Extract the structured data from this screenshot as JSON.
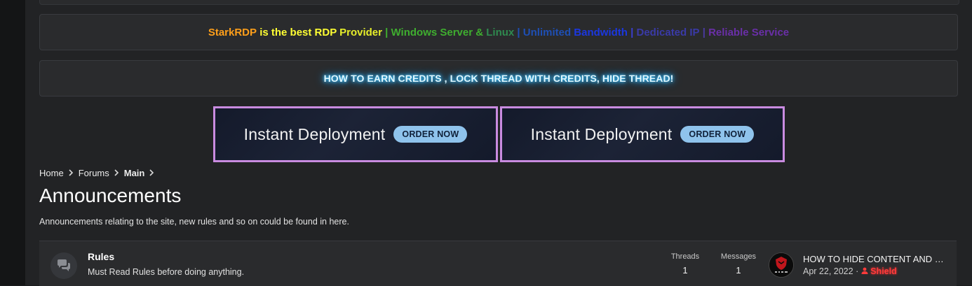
{
  "notice_1": {
    "segments": [
      {
        "text": "StarkRDP",
        "color": "#ff9f1a"
      },
      {
        "text": " is the best RDP ",
        "color": "#ffff33"
      },
      {
        "text": "Provider",
        "color": "#e6ee2a"
      },
      {
        "text": " | Windows Server & ",
        "color": "#3fae2f"
      },
      {
        "text": "Linux",
        "color": "#2f8a4f"
      },
      {
        "text": " | Unlimited ",
        "color": "#1e4fb5"
      },
      {
        "text": "Bandwidth",
        "color": "#1b37e0"
      },
      {
        "text": " | ",
        "color": "#3a3fcf"
      },
      {
        "text": "Dedicated IP",
        "color": "#3a3aa8"
      },
      {
        "text": " | ",
        "color": "#4a3aa0"
      },
      {
        "text": "Reliable Service",
        "color": "#6a2fa8"
      }
    ]
  },
  "notice_2": {
    "text": "HOW TO EARN CREDITS , LOCK THREAD WITH CREDITS, HIDE THREAD!"
  },
  "banners": [
    {
      "title": "Instant Deployment",
      "button": "ORDER NOW"
    },
    {
      "title": "Instant Deployment",
      "button": "ORDER NOW"
    }
  ],
  "breadcrumb": {
    "items": [
      "Home",
      "Forums",
      "Main"
    ]
  },
  "page": {
    "title": "Announcements",
    "description": "Announcements relating to the site, new rules and so on could be found in here."
  },
  "forum": {
    "name": "Rules",
    "description": "Must Read Rules before doing anything.",
    "threads_label": "Threads",
    "threads_value": "1",
    "messages_label": "Messages",
    "messages_value": "1",
    "latest": {
      "title": "HOW TO HIDE CONTENT AND LOCK THREAD WITH CREDITS",
      "date": "Apr 22, 2022",
      "separator": "·",
      "user": "Shield"
    }
  },
  "icons": {
    "forum_icon": "chat-bubbles-icon",
    "breadcrumb_separator": "chevron-right-icon",
    "avatar": "shield-logo-avatar"
  }
}
